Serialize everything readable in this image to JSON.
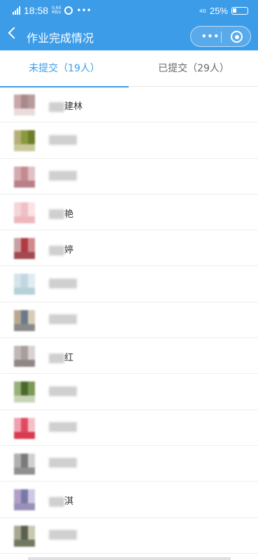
{
  "status_bar": {
    "time": "18:58",
    "speed": "0.60",
    "speed_unit": "KB/s",
    "network": "4G",
    "battery": "25%"
  },
  "nav": {
    "title": "作业完成情况"
  },
  "tabs": [
    {
      "label": "未提交（19人）"
    },
    {
      "label": "已提交（29人）"
    }
  ],
  "students": [
    {
      "name": "建林",
      "avatar": [
        "#c9a6a8",
        "#a88a8c",
        "#b89a9c",
        "#e8dcdc"
      ]
    },
    {
      "name": "",
      "avatar": [
        "#b5b07a",
        "#8a9a3e",
        "#6e7d2a",
        "#c8c89a"
      ]
    },
    {
      "name": "",
      "avatar": [
        "#d4aaae",
        "#c48a90",
        "#e0c0c4",
        "#b88088"
      ]
    },
    {
      "name": "艳",
      "avatar": [
        "#f5d5d8",
        "#f0c0c6",
        "#f8e4e6",
        "#ecb8be"
      ]
    },
    {
      "name": "婷",
      "avatar": [
        "#c9a0a4",
        "#b03a40",
        "#d08a8e",
        "#a24a50"
      ]
    },
    {
      "name": "",
      "avatar": [
        "#d4e4ea",
        "#c0d8e0",
        "#e0ecf0",
        "#b8d0d8"
      ]
    },
    {
      "name": "",
      "avatar": [
        "#b8a890",
        "#6a7a88",
        "#d8ccb8",
        "#8a8a8a"
      ]
    },
    {
      "name": "红",
      "avatar": [
        "#c0b8b8",
        "#a89e9e",
        "#d8d2d2",
        "#908686"
      ]
    },
    {
      "name": "",
      "avatar": [
        "#9ab07a",
        "#4a6a2a",
        "#7a9a58",
        "#c8d4b8"
      ]
    },
    {
      "name": "",
      "avatar": [
        "#f0a0b0",
        "#e04a60",
        "#f4c0c8",
        "#d83a50"
      ]
    },
    {
      "name": "",
      "avatar": [
        "#b0b0b0",
        "#7a7a7a",
        "#d0d0d0",
        "#909090"
      ]
    },
    {
      "name": "淇",
      "avatar": [
        "#b0a0c8",
        "#7a78a8",
        "#d0c8e0",
        "#9890b8"
      ]
    },
    {
      "name": "",
      "avatar": [
        "#a8a890",
        "#5a6050",
        "#c8c8b0",
        "#707860"
      ]
    }
  ]
}
